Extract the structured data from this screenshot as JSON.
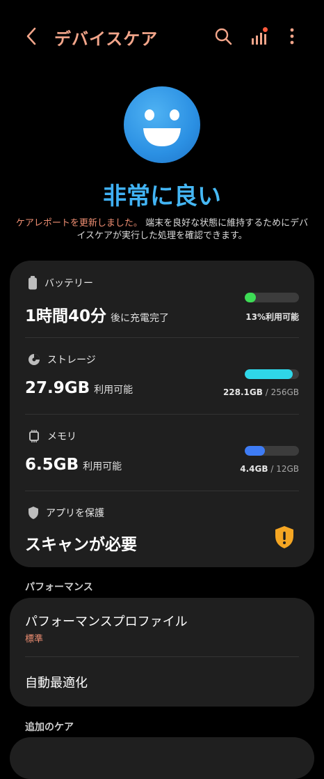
{
  "header": {
    "title": "デバイスケア"
  },
  "status": {
    "label": "非常に良い",
    "desc_highlight": "ケアレポートを更新しました。",
    "desc_rest": "端末を良好な状態に維持するためにデバイスケアが実行した処理を確認できます。"
  },
  "battery": {
    "label": "バッテリー",
    "value": "1時間40分",
    "suffix": "後に充電完了",
    "meta": "13%利用可能",
    "level": 0.13,
    "color": "#3ddc55"
  },
  "storage": {
    "label": "ストレージ",
    "value": "27.9GB",
    "suffix": "利用可能",
    "used": "228.1GB",
    "total": "256GB",
    "sep": " / ",
    "level": 0.89,
    "color": "#2fd6e8"
  },
  "memory": {
    "label": "メモリ",
    "value": "6.5GB",
    "suffix": "利用可能",
    "used": "4.4GB",
    "total": "12GB",
    "sep": " / ",
    "level": 0.37,
    "color": "#3e7cf5"
  },
  "app_protect": {
    "label": "アプリを保護",
    "value": "スキャンが必要",
    "badge_color": "#f5a623"
  },
  "performance": {
    "section": "パフォーマンス",
    "profile_title": "パフォーマンスプロファイル",
    "profile_value": "標準",
    "auto_opt": "自動最適化"
  },
  "extra": {
    "section": "追加のケア"
  }
}
